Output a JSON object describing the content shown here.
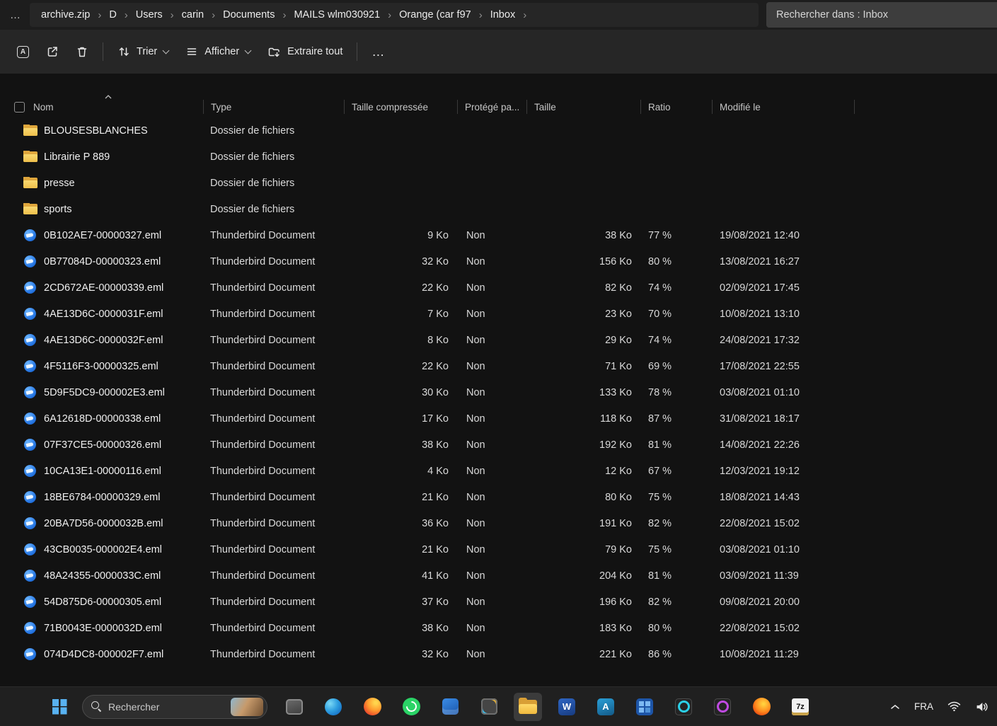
{
  "window": {
    "overflow_label": "…"
  },
  "breadcrumb": {
    "items": [
      "archive.zip",
      "D",
      "Users",
      "carin",
      "Documents",
      "MAILS wlm030921",
      "Orange (car f97",
      "Inbox"
    ]
  },
  "explorer_search": {
    "text": "Rechercher dans : Inbox"
  },
  "toolbar": {
    "sort_label": "Trier",
    "view_label": "Afficher",
    "extract_label": "Extraire tout",
    "more_label": "…"
  },
  "table": {
    "columns": [
      "Nom",
      "Type",
      "Taille compressée",
      "Protégé pa...",
      "Taille",
      "Ratio",
      "Modifié le"
    ],
    "rows": [
      {
        "kind": "folder",
        "name": "BLOUSESBLANCHES",
        "type": "Dossier de fichiers",
        "compressed": "",
        "protected": "",
        "size": "",
        "ratio": "",
        "modified": ""
      },
      {
        "kind": "folder",
        "name": "Librairie P 889",
        "type": "Dossier de fichiers",
        "compressed": "",
        "protected": "",
        "size": "",
        "ratio": "",
        "modified": ""
      },
      {
        "kind": "folder",
        "name": "presse",
        "type": "Dossier de fichiers",
        "compressed": "",
        "protected": "",
        "size": "",
        "ratio": "",
        "modified": ""
      },
      {
        "kind": "folder",
        "name": "sports",
        "type": "Dossier de fichiers",
        "compressed": "",
        "protected": "",
        "size": "",
        "ratio": "",
        "modified": ""
      },
      {
        "kind": "eml",
        "name": "0B102AE7-00000327.eml",
        "type": "Thunderbird Document",
        "compressed": "9 Ko",
        "protected": "Non",
        "size": "38 Ko",
        "ratio": "77 %",
        "modified": "19/08/2021 12:40"
      },
      {
        "kind": "eml",
        "name": "0B77084D-00000323.eml",
        "type": "Thunderbird Document",
        "compressed": "32 Ko",
        "protected": "Non",
        "size": "156 Ko",
        "ratio": "80 %",
        "modified": "13/08/2021 16:27"
      },
      {
        "kind": "eml",
        "name": "2CD672AE-00000339.eml",
        "type": "Thunderbird Document",
        "compressed": "22 Ko",
        "protected": "Non",
        "size": "82 Ko",
        "ratio": "74 %",
        "modified": "02/09/2021 17:45"
      },
      {
        "kind": "eml",
        "name": "4AE13D6C-0000031F.eml",
        "type": "Thunderbird Document",
        "compressed": "7 Ko",
        "protected": "Non",
        "size": "23 Ko",
        "ratio": "70 %",
        "modified": "10/08/2021 13:10"
      },
      {
        "kind": "eml",
        "name": "4AE13D6C-0000032F.eml",
        "type": "Thunderbird Document",
        "compressed": "8 Ko",
        "protected": "Non",
        "size": "29 Ko",
        "ratio": "74 %",
        "modified": "24/08/2021 17:32"
      },
      {
        "kind": "eml",
        "name": "4F5116F3-00000325.eml",
        "type": "Thunderbird Document",
        "compressed": "22 Ko",
        "protected": "Non",
        "size": "71 Ko",
        "ratio": "69 %",
        "modified": "17/08/2021 22:55"
      },
      {
        "kind": "eml",
        "name": "5D9F5DC9-000002E3.eml",
        "type": "Thunderbird Document",
        "compressed": "30 Ko",
        "protected": "Non",
        "size": "133 Ko",
        "ratio": "78 %",
        "modified": "03/08/2021 01:10"
      },
      {
        "kind": "eml",
        "name": "6A12618D-00000338.eml",
        "type": "Thunderbird Document",
        "compressed": "17 Ko",
        "protected": "Non",
        "size": "118 Ko",
        "ratio": "87 %",
        "modified": "31/08/2021 18:17"
      },
      {
        "kind": "eml",
        "name": "07F37CE5-00000326.eml",
        "type": "Thunderbird Document",
        "compressed": "38 Ko",
        "protected": "Non",
        "size": "192 Ko",
        "ratio": "81 %",
        "modified": "14/08/2021 22:26"
      },
      {
        "kind": "eml",
        "name": "10CA13E1-00000116.eml",
        "type": "Thunderbird Document",
        "compressed": "4 Ko",
        "protected": "Non",
        "size": "12 Ko",
        "ratio": "67 %",
        "modified": "12/03/2021 19:12"
      },
      {
        "kind": "eml",
        "name": "18BE6784-00000329.eml",
        "type": "Thunderbird Document",
        "compressed": "21 Ko",
        "protected": "Non",
        "size": "80 Ko",
        "ratio": "75 %",
        "modified": "18/08/2021 14:43"
      },
      {
        "kind": "eml",
        "name": "20BA7D56-0000032B.eml",
        "type": "Thunderbird Document",
        "compressed": "36 Ko",
        "protected": "Non",
        "size": "191 Ko",
        "ratio": "82 %",
        "modified": "22/08/2021 15:02"
      },
      {
        "kind": "eml",
        "name": "43CB0035-000002E4.eml",
        "type": "Thunderbird Document",
        "compressed": "21 Ko",
        "protected": "Non",
        "size": "79 Ko",
        "ratio": "75 %",
        "modified": "03/08/2021 01:10"
      },
      {
        "kind": "eml",
        "name": "48A24355-0000033C.eml",
        "type": "Thunderbird Document",
        "compressed": "41 Ko",
        "protected": "Non",
        "size": "204 Ko",
        "ratio": "81 %",
        "modified": "03/09/2021 11:39"
      },
      {
        "kind": "eml",
        "name": "54D875D6-00000305.eml",
        "type": "Thunderbird Document",
        "compressed": "37 Ko",
        "protected": "Non",
        "size": "196 Ko",
        "ratio": "82 %",
        "modified": "09/08/2021 20:00"
      },
      {
        "kind": "eml",
        "name": "71B0043E-0000032D.eml",
        "type": "Thunderbird Document",
        "compressed": "38 Ko",
        "protected": "Non",
        "size": "183 Ko",
        "ratio": "80 %",
        "modified": "22/08/2021 15:02"
      },
      {
        "kind": "eml",
        "name": "074D4DC8-000002F7.eml",
        "type": "Thunderbird Document",
        "compressed": "32 Ko",
        "protected": "Non",
        "size": "221 Ko",
        "ratio": "86 %",
        "modified": "10/08/2021 11:29"
      }
    ]
  },
  "taskbar": {
    "search_label": "Rechercher",
    "language": "FRA",
    "icons": [
      {
        "name": "photos-icon",
        "style": "ic-photos"
      },
      {
        "name": "edge-icon",
        "style": "ic-edge"
      },
      {
        "name": "firefox-icon",
        "style": "ic-firefox"
      },
      {
        "name": "whatsapp-icon",
        "style": "ic-whatsapp"
      },
      {
        "name": "mail-app-icon",
        "style": "ic-mail"
      },
      {
        "name": "snipping-tool-icon",
        "style": "ic-snip"
      },
      {
        "name": "file-explorer-icon",
        "style": "ic-explorer",
        "active": true
      },
      {
        "name": "word-icon",
        "style": "ic-word",
        "label": "W"
      },
      {
        "name": "a-app-icon",
        "style": "ic-a",
        "label": "A"
      },
      {
        "name": "calculator-icon",
        "style": "ic-calc"
      },
      {
        "name": "dark-app-cyan-icon",
        "style": "ic-app1"
      },
      {
        "name": "dark-app-purple-icon",
        "style": "ic-app2"
      },
      {
        "name": "orange-browser-icon",
        "style": "ic-flame"
      },
      {
        "name": "sevenzip-icon",
        "style": "ic-7z",
        "label": "7z"
      }
    ]
  }
}
